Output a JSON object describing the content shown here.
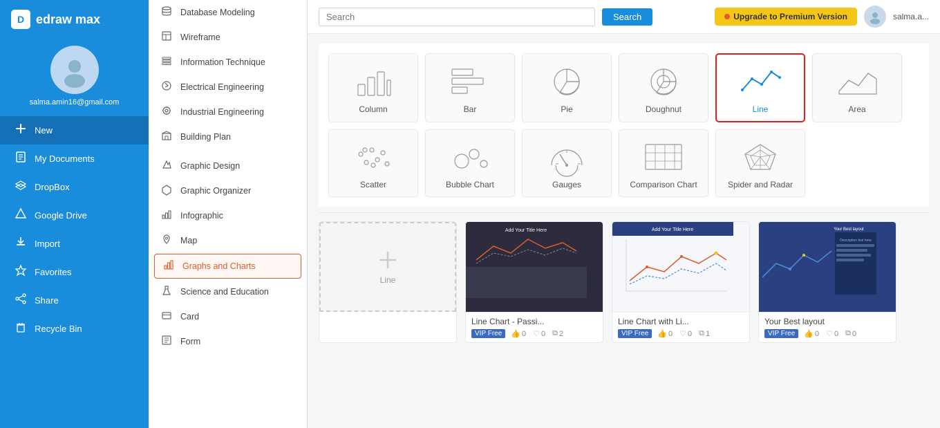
{
  "app": {
    "name": "edraw max"
  },
  "user": {
    "email": "salma.amin16@gmail.com",
    "name": "salma.a..."
  },
  "sidebar": {
    "nav_items": [
      {
        "id": "new",
        "label": "New",
        "icon": "➕",
        "active": true
      },
      {
        "id": "my-documents",
        "label": "My Documents",
        "icon": "📄",
        "active": false
      },
      {
        "id": "dropbox",
        "label": "DropBox",
        "icon": "📦",
        "active": false
      },
      {
        "id": "google-drive",
        "label": "Google Drive",
        "icon": "△",
        "active": false
      },
      {
        "id": "import",
        "label": "Import",
        "icon": "⤵",
        "active": false
      },
      {
        "id": "favorites",
        "label": "Favorites",
        "icon": "★",
        "active": false
      },
      {
        "id": "share",
        "label": "Share",
        "icon": "⇄",
        "active": false
      },
      {
        "id": "recycle-bin",
        "label": "Recycle Bin",
        "icon": "🗑",
        "active": false
      }
    ]
  },
  "middle_panel": {
    "items": [
      {
        "id": "database-modeling",
        "label": "Database Modeling",
        "icon": "🗃"
      },
      {
        "id": "wireframe",
        "label": "Wireframe",
        "icon": "▦"
      },
      {
        "id": "information-technique",
        "label": "Information Technique",
        "icon": "≋"
      },
      {
        "id": "electrical-engineering",
        "label": "Electrical Engineering",
        "icon": "⚡"
      },
      {
        "id": "industrial-engineering",
        "label": "Industrial Engineering",
        "icon": "⚙"
      },
      {
        "id": "building-plan",
        "label": "Building Plan",
        "icon": "🏢"
      },
      {
        "id": "graphic-design",
        "label": "Graphic Design",
        "icon": "✏"
      },
      {
        "id": "graphic-organizer",
        "label": "Graphic Organizer",
        "icon": "❋"
      },
      {
        "id": "infographic",
        "label": "Infographic",
        "icon": "📊"
      },
      {
        "id": "map",
        "label": "Map",
        "icon": "📍"
      },
      {
        "id": "graphs-and-charts",
        "label": "Graphs and Charts",
        "icon": "📈",
        "active": true
      },
      {
        "id": "science-and-education",
        "label": "Science and Education",
        "icon": "⚗"
      },
      {
        "id": "card",
        "label": "Card",
        "icon": "🃏"
      },
      {
        "id": "form",
        "label": "Form",
        "icon": "▤"
      }
    ]
  },
  "topbar": {
    "search_placeholder": "Search",
    "search_button": "Search",
    "upgrade_label": "Upgrade to Premium Version",
    "user_name": "salma.a..."
  },
  "chart_types": [
    {
      "id": "column",
      "label": "Column",
      "selected": false
    },
    {
      "id": "bar",
      "label": "Bar",
      "selected": false
    },
    {
      "id": "pie",
      "label": "Pie",
      "selected": false
    },
    {
      "id": "doughnut",
      "label": "Doughnut",
      "selected": false
    },
    {
      "id": "line",
      "label": "Line",
      "selected": true
    },
    {
      "id": "area",
      "label": "Area",
      "selected": false
    },
    {
      "id": "scatter",
      "label": "Scatter",
      "selected": false
    },
    {
      "id": "bubble-chart",
      "label": "Bubble Chart",
      "selected": false
    },
    {
      "id": "gauges",
      "label": "Gauges",
      "selected": false
    },
    {
      "id": "comparison-chart",
      "label": "Comparison Chart",
      "selected": false
    },
    {
      "id": "spider-and-radar",
      "label": "Spider and Radar",
      "selected": false
    }
  ],
  "templates": [
    {
      "id": "new-line",
      "label": "Line",
      "type": "new",
      "vip": false,
      "likes": null,
      "hearts": null,
      "copies": null
    },
    {
      "id": "line-chart-passi",
      "label": "Line Chart - Passi...",
      "type": "preview",
      "vip": true,
      "vip_label": "VIP Free",
      "likes": 0,
      "hearts": 0,
      "copies": 2
    },
    {
      "id": "line-chart-li",
      "label": "Line Chart with Li...",
      "type": "preview2",
      "vip": true,
      "vip_label": "VIP Free",
      "likes": 0,
      "hearts": 0,
      "copies": 1
    },
    {
      "id": "template-4",
      "label": "Your Best layout",
      "type": "preview3",
      "vip": true,
      "vip_label": "VIP Free",
      "likes": 0,
      "hearts": 0,
      "copies": 0
    }
  ]
}
